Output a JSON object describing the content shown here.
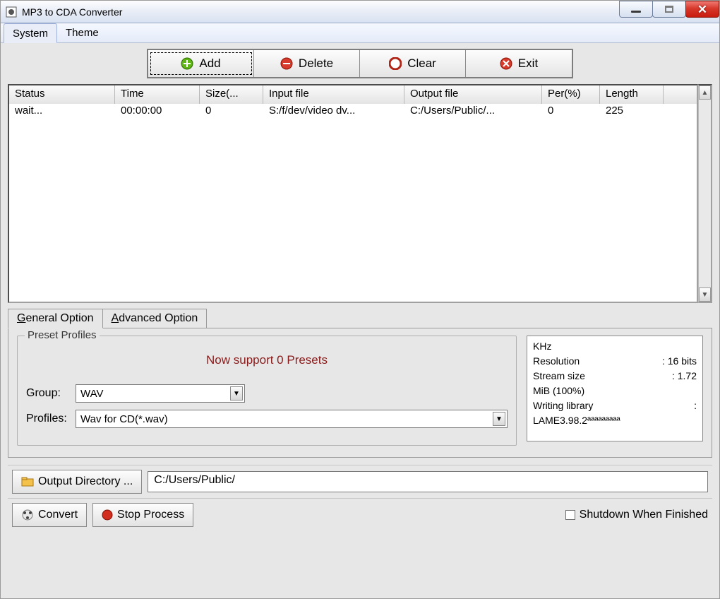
{
  "title": "MP3 to CDA Converter",
  "menubar": {
    "items": [
      "System",
      "Theme"
    ],
    "active": 0
  },
  "toolbar": {
    "add": "Add",
    "delete": "Delete",
    "clear": "Clear",
    "exit": "Exit"
  },
  "grid": {
    "columns": [
      "Status",
      "Time",
      "Size(...",
      "Input file",
      "Output file",
      "Per(%)",
      "Length"
    ],
    "rows": [
      {
        "status": "wait...",
        "time": "00:00:00",
        "size": "0",
        "input": "S:/f/dev/video dv...",
        "output": "C:/Users/Public/...",
        "per": "0",
        "length": "225"
      }
    ]
  },
  "tabs": {
    "general": "General Option",
    "advanced": "Advanced Option",
    "active": "general"
  },
  "presets": {
    "legend": "Preset Profiles",
    "message": "Now support 0 Presets",
    "group_label": "Group:",
    "group_value": "WAV",
    "profiles_label": "Profiles:",
    "profiles_value": "Wav for CD(*.wav)"
  },
  "info": {
    "lines": [
      {
        "k": "KHz",
        "v": ""
      },
      {
        "k": "Resolution",
        "v": ": 16 bits"
      },
      {
        "k": "Stream size",
        "v": ": 1.72"
      },
      {
        "k": "MiB (100%)",
        "v": ""
      },
      {
        "k": "Writing library",
        "v": ":"
      },
      {
        "k": "LAME3.98.2ªªªªªªªªª",
        "v": ""
      }
    ]
  },
  "output": {
    "button": "Output Directory ...",
    "path": "C:/Users/Public/"
  },
  "footer": {
    "convert": "Convert",
    "stop": "Stop Process",
    "shutdown": "Shutdown When Finished"
  }
}
